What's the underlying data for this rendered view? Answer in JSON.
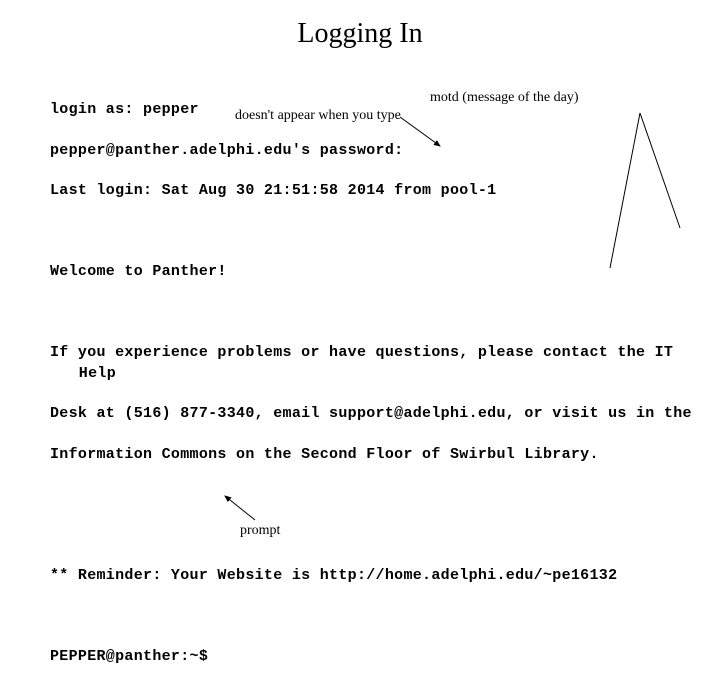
{
  "title": "Logging In",
  "annotations": {
    "motd": "motd (message of the day)",
    "password_note": "doesn't appear when you type",
    "prompt_note": "prompt"
  },
  "terminal": {
    "login_as": "login as: pepper",
    "password_prompt": "pepper@panther.adelphi.edu's password:",
    "last_login": "Last login: Sat Aug 30 21:51:58 2014 from pool-1",
    "welcome": "Welcome to Panther!",
    "help1": "If you experience problems or have questions, please contact the IT Help",
    "help2": "Desk at (516) 877-3340, email support@adelphi.edu, or visit us in the",
    "help3": "Information Commons on the Second Floor of Swirbul Library.",
    "reminder": "** Reminder: Your Website is http://home.adelphi.edu/~pe16132",
    "prompt": "PEPPER@panther:~$"
  }
}
